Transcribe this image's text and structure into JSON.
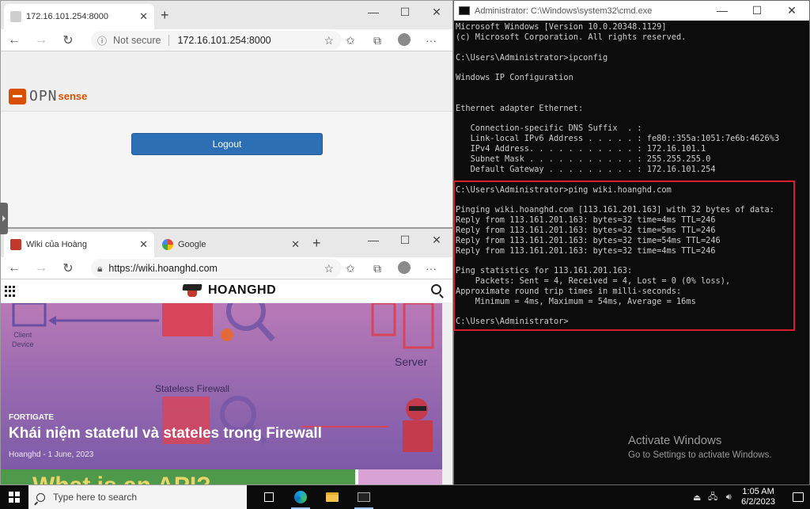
{
  "browser_top": {
    "tab_title": "172.16.101.254:8000",
    "address_security": "Not secure",
    "address_url": "172.16.101.254:8000",
    "page": {
      "logo_opn": "OPN",
      "logo_sense": "sense",
      "logout_label": "Logout"
    }
  },
  "browser_bottom": {
    "tab1_title": "Wiki của Hoàng",
    "tab2_title": "Google",
    "address_url": "https://wiki.hoanghd.com",
    "site_logo": "HOANGHD",
    "hero": {
      "label_client": "Client\nDevice",
      "label_server": "Server",
      "label_stateless": "Stateless Firewall",
      "category": "FORTIGATE",
      "title": "Khái niệm stateful và stateles trong Firewall",
      "meta": "Hoanghd - 1 June, 2023",
      "next_banner": "What is an API?"
    }
  },
  "cmd": {
    "title": "Administrator: C:\\Windows\\system32\\cmd.exe",
    "lines": [
      "Microsoft Windows [Version 10.0.20348.1129]",
      "(c) Microsoft Corporation. All rights reserved.",
      "",
      "C:\\Users\\Administrator>ipconfig",
      "",
      "Windows IP Configuration",
      "",
      "",
      "Ethernet adapter Ethernet:",
      "",
      "   Connection-specific DNS Suffix  . :",
      "   Link-local IPv6 Address . . . . . : fe80::355a:1051:7e6b:4626%3",
      "   IPv4 Address. . . . . . . . . . . : 172.16.101.1",
      "   Subnet Mask . . . . . . . . . . . : 255.255.255.0",
      "   Default Gateway . . . . . . . . . : 172.16.101.254",
      "",
      "C:\\Users\\Administrator>ping wiki.hoanghd.com",
      "",
      "Pinging wiki.hoanghd.com [113.161.201.163] with 32 bytes of data:",
      "Reply from 113.161.201.163: bytes=32 time=4ms TTL=246",
      "Reply from 113.161.201.163: bytes=32 time=5ms TTL=246",
      "Reply from 113.161.201.163: bytes=32 time=54ms TTL=246",
      "Reply from 113.161.201.163: bytes=32 time=4ms TTL=246",
      "",
      "Ping statistics for 113.161.201.163:",
      "    Packets: Sent = 4, Received = 4, Lost = 0 (0% loss),",
      "Approximate round trip times in milli-seconds:",
      "    Minimum = 4ms, Maximum = 54ms, Average = 16ms",
      "",
      "C:\\Users\\Administrator>"
    ]
  },
  "watermark": {
    "line1": "Activate Windows",
    "line2": "Go to Settings to activate Windows."
  },
  "taskbar": {
    "search_placeholder": "Type here to search",
    "time": "1:05 AM",
    "date": "6/2/2023"
  },
  "colors": {
    "logout_button": "#2d6fb5",
    "highlight_box": "#d91e2e",
    "opnsense_orange": "#d94f00"
  }
}
